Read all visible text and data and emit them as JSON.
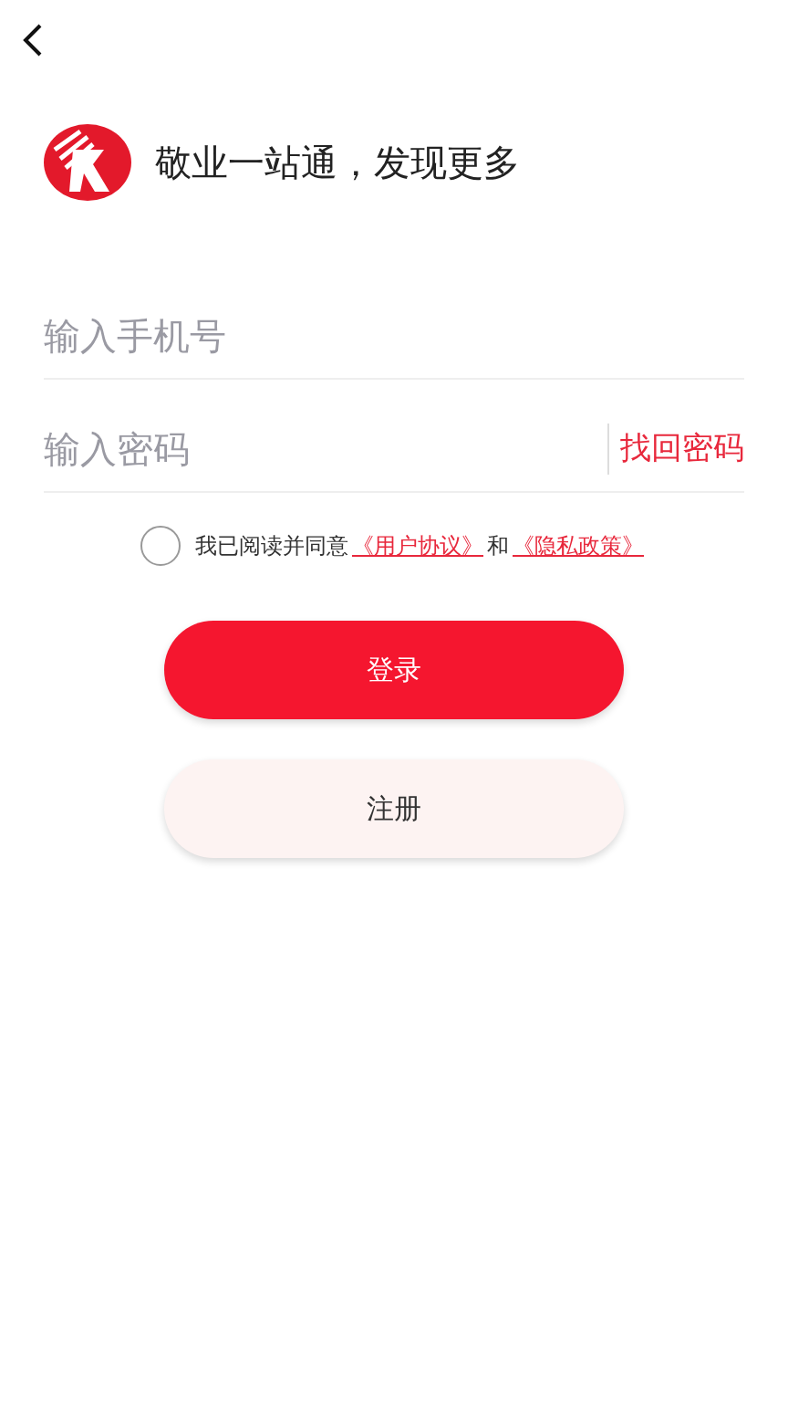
{
  "brand": {
    "slogan": "敬业一站通，发现更多"
  },
  "phone_field": {
    "placeholder": "输入手机号"
  },
  "password_field": {
    "placeholder": "输入密码",
    "action": "找回密码"
  },
  "agreement": {
    "checked": false,
    "text": "我已阅读并同意",
    "link_1": "《用户协议》",
    "joiner": "和",
    "link_2": "《隐私政策》"
  },
  "buttons": [
    {
      "label": "登录",
      "kind": "primary"
    },
    {
      "label": "注册",
      "kind": "secondary"
    }
  ]
}
